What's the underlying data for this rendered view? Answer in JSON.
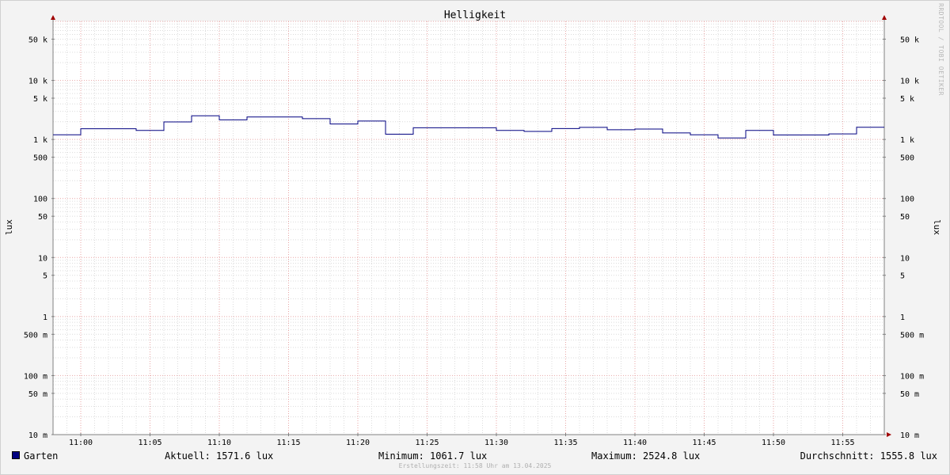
{
  "chart_data": {
    "type": "line",
    "title": "Helligkeit",
    "ylabel": "lux",
    "y_scale": "log",
    "ylim": [
      0.01,
      100000
    ],
    "grid": true,
    "y_ticks": [
      {
        "value": 50000,
        "label": "50 k"
      },
      {
        "value": 10000,
        "label": "10 k"
      },
      {
        "value": 5000,
        "label": "5 k"
      },
      {
        "value": 1000,
        "label": "1 k"
      },
      {
        "value": 500,
        "label": "500"
      },
      {
        "value": 100,
        "label": "100"
      },
      {
        "value": 50,
        "label": "50"
      },
      {
        "value": 10,
        "label": "10"
      },
      {
        "value": 5,
        "label": "5"
      },
      {
        "value": 1,
        "label": "1"
      },
      {
        "value": 0.5,
        "label": "500 m"
      },
      {
        "value": 0.1,
        "label": "100 m"
      },
      {
        "value": 0.05,
        "label": "50 m"
      },
      {
        "value": 0.01,
        "label": "10 m"
      }
    ],
    "x_ticks": [
      "11:00",
      "11:05",
      "11:10",
      "11:15",
      "11:20",
      "11:25",
      "11:30",
      "11:35",
      "11:40",
      "11:45",
      "11:50",
      "11:55"
    ],
    "xlim": [
      "10:58",
      "11:58"
    ],
    "series": [
      {
        "name": "Garten",
        "color": "#000080",
        "step": true,
        "points": [
          {
            "x": "10:58",
            "y": 1200
          },
          {
            "x": "11:00",
            "y": 1520
          },
          {
            "x": "11:04",
            "y": 1420
          },
          {
            "x": "11:06",
            "y": 1980
          },
          {
            "x": "11:08",
            "y": 2520
          },
          {
            "x": "11:10",
            "y": 2150
          },
          {
            "x": "11:12",
            "y": 2400
          },
          {
            "x": "11:16",
            "y": 2250
          },
          {
            "x": "11:18",
            "y": 1830
          },
          {
            "x": "11:20",
            "y": 2050
          },
          {
            "x": "11:22",
            "y": 1230
          },
          {
            "x": "11:24",
            "y": 1580
          },
          {
            "x": "11:30",
            "y": 1420
          },
          {
            "x": "11:32",
            "y": 1370
          },
          {
            "x": "11:34",
            "y": 1530
          },
          {
            "x": "11:36",
            "y": 1600
          },
          {
            "x": "11:38",
            "y": 1460
          },
          {
            "x": "11:40",
            "y": 1500
          },
          {
            "x": "11:42",
            "y": 1290
          },
          {
            "x": "11:44",
            "y": 1200
          },
          {
            "x": "11:46",
            "y": 1060
          },
          {
            "x": "11:48",
            "y": 1420
          },
          {
            "x": "11:50",
            "y": 1190
          },
          {
            "x": "11:54",
            "y": 1240
          },
          {
            "x": "11:56",
            "y": 1610
          },
          {
            "x": "11:58",
            "y": 1610
          }
        ]
      }
    ]
  },
  "legend": {
    "series_name": "Garten",
    "swatch_color": "#000080",
    "current": "Aktuell: 1571.6 lux",
    "minimum": "Minimum: 1061.7 lux",
    "maximum": "Maximum: 2524.8 lux",
    "average": "Durchschnitt: 1555.8 lux"
  },
  "footer": "Erstellungszeit: 11:58 Uhr am 13.04.2025",
  "watermark": "RRDTOOL / TOBI OETIKER"
}
